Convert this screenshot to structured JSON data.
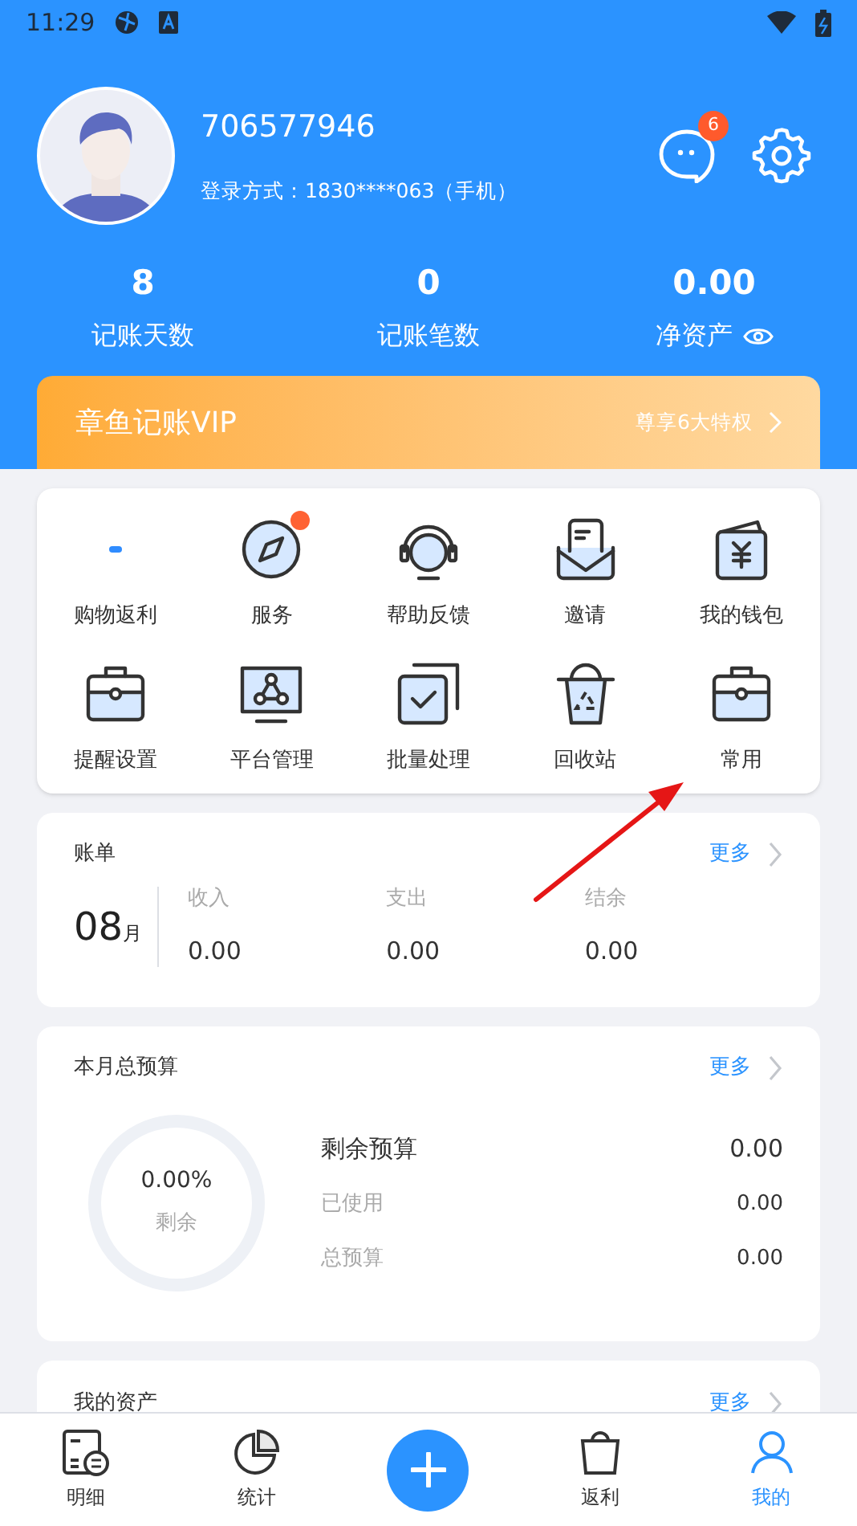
{
  "status_bar": {
    "time": "11:29"
  },
  "profile": {
    "user_id": "706577946",
    "login": "登录方式：1830****063（手机）",
    "message_badge": "6"
  },
  "stats": [
    {
      "value": "8",
      "label": "记账天数",
      "eye": false
    },
    {
      "value": "0",
      "label": "记账笔数",
      "eye": false
    },
    {
      "value": "0.00",
      "label": "净资产",
      "eye": true
    }
  ],
  "vip": {
    "title": "章鱼记账VIP",
    "link": "尊享6大特权"
  },
  "shortcuts": [
    {
      "label": "购物返利",
      "dot": false
    },
    {
      "label": "服务",
      "dot": true
    },
    {
      "label": "帮助反馈",
      "dot": false
    },
    {
      "label": "邀请",
      "dot": false
    },
    {
      "label": "我的钱包",
      "dot": false
    },
    {
      "label": "提醒设置",
      "dot": false
    },
    {
      "label": "平台管理",
      "dot": false
    },
    {
      "label": "批量处理",
      "dot": false
    },
    {
      "label": "回收站",
      "dot": false
    },
    {
      "label": "常用",
      "dot": false
    }
  ],
  "bill": {
    "title": "账单",
    "more": "更多",
    "month": "08",
    "month_unit": "月",
    "columns": [
      {
        "label": "收入",
        "value": "0.00"
      },
      {
        "label": "支出",
        "value": "0.00"
      },
      {
        "label": "结余",
        "value": "0.00"
      }
    ]
  },
  "budget": {
    "title": "本月总预算",
    "more": "更多",
    "percent": "0.00%",
    "percent_label": "剩余",
    "rows": [
      {
        "label": "剩余预算",
        "value": "0.00",
        "kind": "main"
      },
      {
        "label": "已使用",
        "value": "0.00",
        "kind": "sub"
      },
      {
        "label": "总预算",
        "value": "0.00",
        "kind": "sub"
      }
    ]
  },
  "assets": {
    "title": "我的资产",
    "more": "更多"
  },
  "tab_bar": [
    {
      "label": "明细",
      "selected": false,
      "kind": "tab"
    },
    {
      "label": "统计",
      "selected": false,
      "kind": "tab"
    },
    {
      "kind": "add"
    },
    {
      "label": "返利",
      "selected": false,
      "kind": "tab"
    },
    {
      "label": "我的",
      "selected": true,
      "kind": "tab"
    }
  ]
}
